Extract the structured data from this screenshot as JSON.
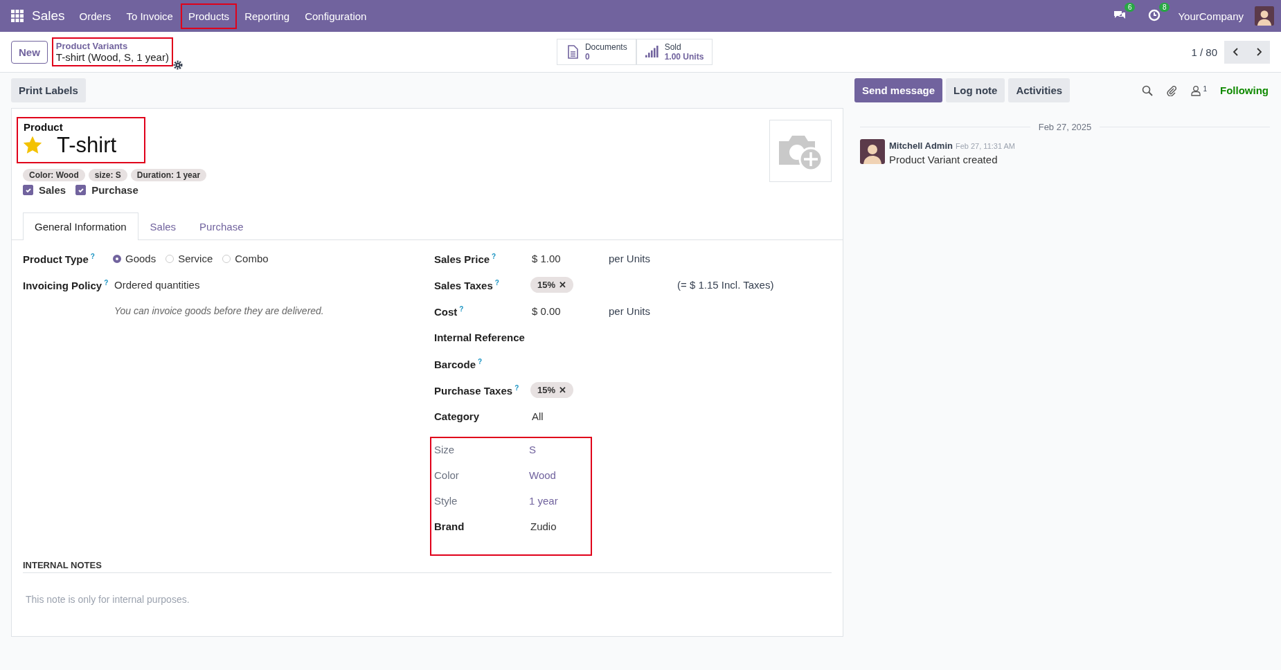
{
  "navbar": {
    "app": "Sales",
    "menu": [
      {
        "label": "Orders",
        "highlighted": false
      },
      {
        "label": "To Invoice",
        "highlighted": false
      },
      {
        "label": "Products",
        "highlighted": true
      },
      {
        "label": "Reporting",
        "highlighted": false
      },
      {
        "label": "Configuration",
        "highlighted": false
      }
    ],
    "messages_badge": "6",
    "activities_badge": "8",
    "company": "YourCompany"
  },
  "control_panel": {
    "new_button": "New",
    "breadcrumb": {
      "parent": "Product Variants",
      "current": "T-shirt (Wood, S, 1 year)",
      "highlighted": true
    },
    "smart_buttons": [
      {
        "kind": "documents",
        "label": "Documents",
        "value": "0"
      },
      {
        "kind": "sold",
        "label": "Sold",
        "value": "1.00 Units"
      }
    ],
    "pager": "1 / 80"
  },
  "actions": [
    "Print Labels"
  ],
  "form": {
    "title_label": "Product",
    "title": "T-shirt",
    "favorite": true,
    "title_highlighted": true,
    "tags": [
      "Color: Wood",
      "size: S",
      "Duration: 1 year"
    ],
    "checkboxes": [
      {
        "label": "Sales",
        "checked": true
      },
      {
        "label": "Purchase",
        "checked": true
      }
    ],
    "tabs": [
      {
        "label": "General Information",
        "selected": true
      },
      {
        "label": "Sales",
        "selected": false
      },
      {
        "label": "Purchase",
        "selected": false
      }
    ],
    "left_fields": [
      {
        "kind": "radio",
        "label": "Product Type",
        "help": "?",
        "options": [
          {
            "label": "Goods",
            "selected": true
          },
          {
            "label": "Service",
            "selected": false
          },
          {
            "label": "Combo",
            "selected": false
          }
        ]
      },
      {
        "kind": "text",
        "label": "Invoicing Policy",
        "help": "?",
        "value": "Ordered quantities",
        "note": "You can invoice goods before they are delivered."
      }
    ],
    "right_fields": [
      {
        "kind": "text",
        "label": "Sales Price",
        "help": "?",
        "value": "$ 1.00",
        "suffix": "per  Units"
      },
      {
        "kind": "tag",
        "label": "Sales Taxes",
        "help": "?",
        "value": "15%",
        "remove": "✕",
        "extra": "(= $ 1.15 Incl. Taxes)"
      },
      {
        "kind": "text",
        "label": "Cost",
        "help": "?",
        "value": "$ 0.00",
        "suffix": "per Units"
      },
      {
        "kind": "empty",
        "label": "Internal Reference"
      },
      {
        "kind": "empty",
        "label": "Barcode",
        "help": "?"
      },
      {
        "kind": "tag",
        "label": "Purchase Taxes",
        "help": "?",
        "value": "15%",
        "remove": "✕"
      },
      {
        "kind": "text",
        "label": "Category",
        "value": "All"
      }
    ],
    "attributes": {
      "highlighted": true,
      "rows": [
        {
          "kind": "attribute",
          "label": "Size",
          "value": "S"
        },
        {
          "kind": "attribute",
          "label": "Color",
          "value": "Wood"
        },
        {
          "kind": "attribute",
          "label": "Style",
          "value": "1 year"
        },
        {
          "kind": "text",
          "label": "Brand",
          "value": "Zudio"
        }
      ]
    },
    "notes_heading": "INTERNAL NOTES",
    "notes_placeholder": "This note is only for internal purposes."
  },
  "chatter": {
    "buttons": [
      {
        "label": "Send message",
        "selected": true
      },
      {
        "label": "Log note",
        "selected": false
      },
      {
        "label": "Activities",
        "selected": false
      }
    ],
    "followers": "1",
    "following": "Following",
    "date": "Feb 27, 2025",
    "messages": [
      {
        "author": "Mitchell Admin",
        "time": "Feb 27, 11:31 AM",
        "body": "Product Variant created"
      }
    ]
  }
}
